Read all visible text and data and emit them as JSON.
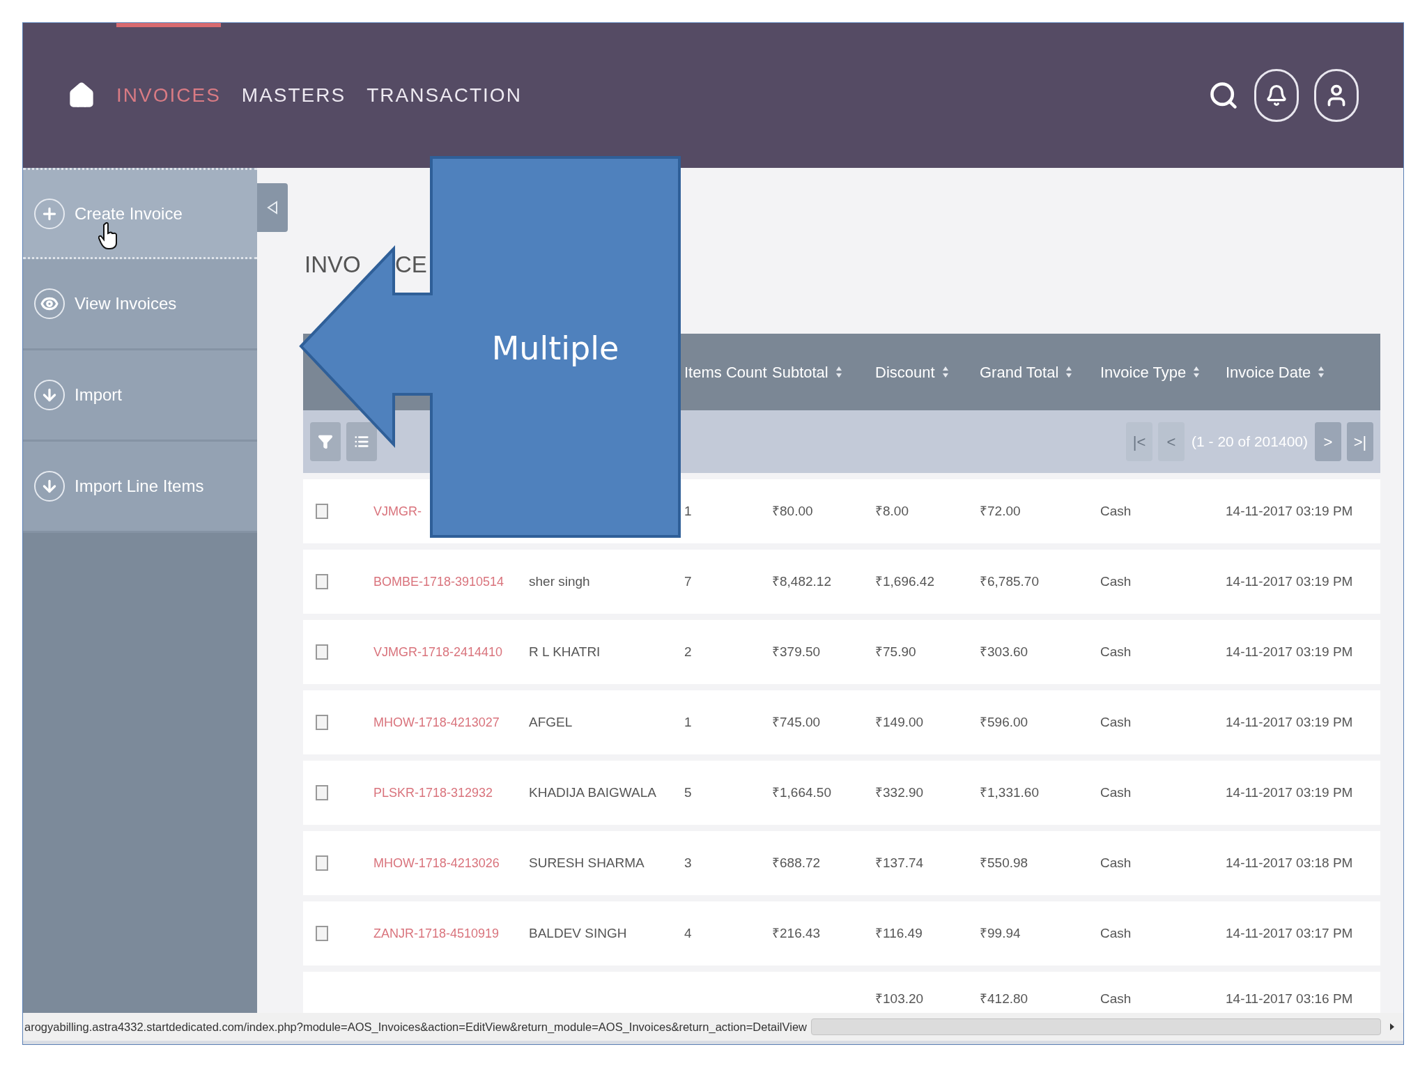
{
  "nav": {
    "items": [
      {
        "label": "INVOICES",
        "selected": true
      },
      {
        "label": "MASTERS",
        "selected": false
      },
      {
        "label": "TRANSACTION",
        "selected": false
      }
    ]
  },
  "sidebar": {
    "items": [
      {
        "label": "Create Invoice",
        "selected": true
      },
      {
        "label": "View Invoices",
        "selected": false
      },
      {
        "label": "Import",
        "selected": false
      },
      {
        "label": "Import Line Items",
        "selected": false
      }
    ]
  },
  "heading": {
    "parts": [
      "INVO",
      "CE"
    ]
  },
  "callout": {
    "label": "Multiple"
  },
  "table": {
    "columns": [
      {
        "label": "Items Count",
        "sortable": false
      },
      {
        "label": "Subtotal",
        "sortable": true
      },
      {
        "label": "Discount",
        "sortable": true
      },
      {
        "label": "Grand Total",
        "sortable": true
      },
      {
        "label": "Invoice Type",
        "sortable": true
      },
      {
        "label": "Invoice Date",
        "sortable": true
      }
    ],
    "pagination": {
      "buttons": [
        {
          "label": "|<",
          "disabled": true
        },
        {
          "label": "<",
          "disabled": true
        },
        {
          "label": ">",
          "disabled": false
        },
        {
          "label": ">|",
          "disabled": false
        }
      ],
      "range": "(1 - 20 of 201400)"
    },
    "rows": [
      {
        "checked": false,
        "number": "VJMGR-",
        "items_count": "1",
        "subtotal": "₹80.00",
        "discount": "₹8.00",
        "grand_total": "₹72.00",
        "type": "Cash",
        "date": "14-11-2017 03:19 PM"
      },
      {
        "checked": false,
        "number": "BOMBE-1718-3910514",
        "account": "sher singh",
        "items_count": "7",
        "subtotal": "₹8,482.12",
        "discount": "₹1,696.42",
        "grand_total": "₹6,785.70",
        "type": "Cash",
        "date": "14-11-2017 03:19 PM"
      },
      {
        "checked": false,
        "number": "VJMGR-1718-2414410",
        "account": "R L KHATRI",
        "items_count": "2",
        "subtotal": "₹379.50",
        "discount": "₹75.90",
        "grand_total": "₹303.60",
        "type": "Cash",
        "date": "14-11-2017 03:19 PM"
      },
      {
        "checked": false,
        "number": "MHOW-1718-4213027",
        "account": "AFGEL",
        "items_count": "1",
        "subtotal": "₹745.00",
        "discount": "₹149.00",
        "grand_total": "₹596.00",
        "type": "Cash",
        "date": "14-11-2017 03:19 PM"
      },
      {
        "checked": false,
        "number": "PLSKR-1718-312932",
        "account": "KHADIJA BAIGWALA",
        "items_count": "5",
        "subtotal": "₹1,664.50",
        "discount": "₹332.90",
        "grand_total": "₹1,331.60",
        "type": "Cash",
        "date": "14-11-2017 03:19 PM"
      },
      {
        "checked": false,
        "number": "MHOW-1718-4213026",
        "account": "SURESH SHARMA",
        "items_count": "3",
        "subtotal": "₹688.72",
        "discount": "₹137.74",
        "grand_total": "₹550.98",
        "type": "Cash",
        "date": "14-11-2017 03:18 PM"
      },
      {
        "checked": false,
        "number": "ZANJR-1718-4510919",
        "account": "BALDEV SINGH",
        "items_count": "4",
        "subtotal": "₹216.43",
        "discount": "₹116.49",
        "grand_total": "₹99.94",
        "type": "Cash",
        "date": "14-11-2017 03:17 PM"
      },
      {
        "discount": "₹103.20",
        "grand_total": "₹412.80",
        "type": "Cash",
        "date": "14-11-2017 03:16 PM"
      }
    ]
  },
  "status_bar": {
    "url": "arogyabilling.astra4332.startdedicated.com/index.php?module=AOS_Invoices&action=EditView&return_module=AOS_Invoices&return_action=DetailView"
  }
}
